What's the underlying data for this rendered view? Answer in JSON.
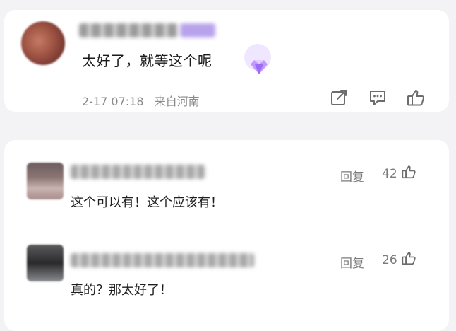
{
  "main_comment": {
    "text": "太好了，就等这个呢",
    "date": "2-17 07:18",
    "location": "来自河南"
  },
  "replies": [
    {
      "text": "这个可以有！这个应该有！",
      "reply_label": "回复",
      "likes": "42"
    },
    {
      "text": "真的？那太好了！",
      "reply_label": "回复",
      "likes": "26"
    }
  ],
  "colors": {
    "accent": "#b58cff",
    "muted": "#8a8a8a"
  },
  "icons": {
    "share": "share-icon",
    "comment": "comment-icon",
    "like": "thumbs-up-icon",
    "gem": "gem-icon"
  }
}
